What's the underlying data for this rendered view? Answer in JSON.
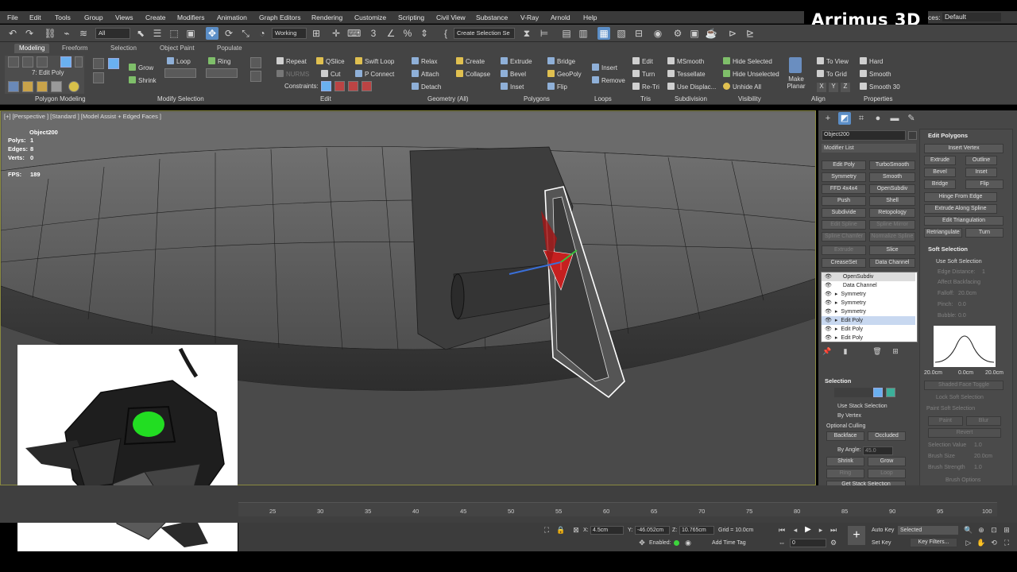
{
  "menubar": {
    "items": [
      "File",
      "Edit",
      "Tools",
      "Group",
      "Views",
      "Create",
      "Modifiers",
      "Animation",
      "Graph Editors",
      "Rendering",
      "Customize",
      "Scripting",
      "Civil View",
      "Substance",
      "V-Ray",
      "Arnold",
      "Help"
    ],
    "workspace_label": "ces:",
    "workspace_value": "Default"
  },
  "logo": "Arrimus 3D",
  "toolbar": {
    "selection_filter": "All",
    "ref_coord": "Working",
    "named_selection": "Create Selection Se"
  },
  "ribbon": {
    "tabs": [
      "Modeling",
      "Freeform",
      "Selection",
      "Object Paint",
      "Populate"
    ],
    "mode_label": "7: Edit Poly",
    "panel_names": [
      "Polygon Modeling",
      "Modify Selection",
      "Edit",
      "Geometry (All)",
      "Polygons",
      "Loops",
      "Tris",
      "Subdivision",
      "Visibility",
      "Align",
      "Properties"
    ],
    "modsel": {
      "grow": "Grow",
      "shrink": "Shrink",
      "loop": "Loop",
      "ring": "Ring"
    },
    "edit": {
      "repeat": "Repeat",
      "qslice": "QSlice",
      "swift_loop": "Swift Loop",
      "nurms": "NURMS",
      "cut": "Cut",
      "p_connect": "P Connect",
      "constraints": "Constraints:"
    },
    "geometry": {
      "relax": "Relax",
      "create": "Create",
      "attach": "Attach",
      "collapse": "Collapse",
      "detach": "Detach"
    },
    "polygons": {
      "extrude": "Extrude",
      "bridge": "Bridge",
      "bevel": "Bevel",
      "geopoly": "GeoPoly",
      "inset": "Inset",
      "flip": "Flip"
    },
    "loops": {
      "insert": "Insert",
      "remove": "Remove"
    },
    "tris": {
      "edit": "Edit",
      "turn": "Turn",
      "retri": "Re-Tri"
    },
    "subdivision": {
      "msmooth": "MSmooth",
      "tessellate": "Tessellate",
      "use_displac": "Use Displac..."
    },
    "visibility": {
      "hide_selected": "Hide Selected",
      "hide_unselected": "Hide Unselected",
      "unhide_all": "Unhide All"
    },
    "align": {
      "make_planar": "Make Planar",
      "to_view": "To View",
      "to_grid": "To Grid",
      "xyz": [
        "X",
        "Y",
        "Z"
      ]
    },
    "properties": {
      "hard": "Hard",
      "smooth": "Smooth",
      "smooth30": "Smooth 30"
    }
  },
  "viewport": {
    "label": "[+] [Perspective ] [Standard ] [Model Assist + Edged Faces ]",
    "object": "Object200",
    "stats": [
      {
        "k": "Polys:",
        "v": "1"
      },
      {
        "k": "Edges:",
        "v": "8"
      },
      {
        "k": "Verts:",
        "v": "0"
      }
    ],
    "fps_label": "FPS:",
    "fps": "189"
  },
  "command_panel": {
    "object_name": "Object200",
    "modifier_list": "Modifier List",
    "modifier_buttons": [
      [
        "Edit Poly",
        "TurboSmooth"
      ],
      [
        "Symmetry",
        "Smooth"
      ],
      [
        "FFD 4x4x4",
        "OpenSubdiv"
      ],
      [
        "Push",
        "Shell"
      ],
      [
        "Subdivide",
        "Retopology"
      ],
      [
        "Edit Spline",
        "Spline Mirror"
      ],
      [
        "Spline Chamfer",
        "Normalize Spline"
      ],
      [
        "Extrude",
        "Slice"
      ],
      [
        "CreaseSet",
        "Data Channel"
      ]
    ],
    "stack": [
      "OpenSubdiv",
      "Data Channel",
      "Symmetry",
      "Symmetry",
      "Symmetry",
      "Edit Poly",
      "Edit Poly",
      "Edit Poly"
    ],
    "selection": {
      "header": "Selection",
      "use_stack": "Use Stack Selection",
      "by_vertex": "By Vertex",
      "optional_culling": "Optional Culling",
      "backface": "Backface",
      "occluded": "Occluded",
      "by_angle": "By Angle:",
      "angle": "45.0",
      "shrink": "Shrink",
      "grow": "Grow",
      "ring": "Ring",
      "loop": "Loop",
      "get_stack": "Get Stack Selection"
    },
    "edit_polygons": {
      "header": "Edit Polygons",
      "insert_vertex": "Insert Vertex",
      "extrude": "Extrude",
      "outline": "Outline",
      "bevel": "Bevel",
      "inset": "Inset",
      "bridge": "Bridge",
      "flip": "Flip",
      "hinge": "Hinge From Edge",
      "extrude_spline": "Extrude Along Spline",
      "edit_tri": "Edit Triangulation",
      "retriangulate": "Retriangulate",
      "turn": "Turn"
    },
    "soft_selection": {
      "header": "Soft Selection",
      "use_soft": "Use Soft Selection",
      "edge_distance": "Edge Distance:",
      "edge_distance_val": "1",
      "affect_backfacing": "Affect Backfacing",
      "falloff": "Falloff:",
      "falloff_val": "20.0cm",
      "pinch": "Pinch:",
      "pinch_val": "0.0",
      "bubble": "Bubble:",
      "bubble_val": "0.0",
      "curve_labels": [
        "20.0cm",
        "0.0cm",
        "20.0cm"
      ],
      "shaded_face": "Shaded Face Toggle",
      "lock_soft": "Lock Soft Selection",
      "paint_soft": "Paint Soft Selection",
      "paint": "Paint",
      "blur": "Blur",
      "revert": "Revert",
      "selection_value": "Selection Value",
      "selection_value_val": "1.0",
      "brush_size": "Brush Size",
      "brush_size_val": "20.0cm",
      "brush_strength": "Brush Strength",
      "brush_strength_val": "1.0",
      "brush_options": "Brush Options"
    }
  },
  "timeline": {
    "ticks": [
      "25",
      "30",
      "35",
      "40",
      "45",
      "50",
      "55",
      "60",
      "65",
      "70",
      "75",
      "80",
      "85",
      "90",
      "95",
      "100"
    ]
  },
  "status": {
    "x_label": "X:",
    "x": "4.5cm",
    "y_label": "Y:",
    "y": "-46.052cm",
    "z_label": "Z:",
    "z": "10.765cm",
    "grid": "Grid = 10.0cm",
    "enabled": "Enabled:",
    "add_time_tag": "Add Time Tag",
    "frame": "0",
    "auto_key": "Auto Key",
    "auto_key_value": "Selected",
    "set_key": "Set Key",
    "key_filters": "Key Filters..."
  }
}
